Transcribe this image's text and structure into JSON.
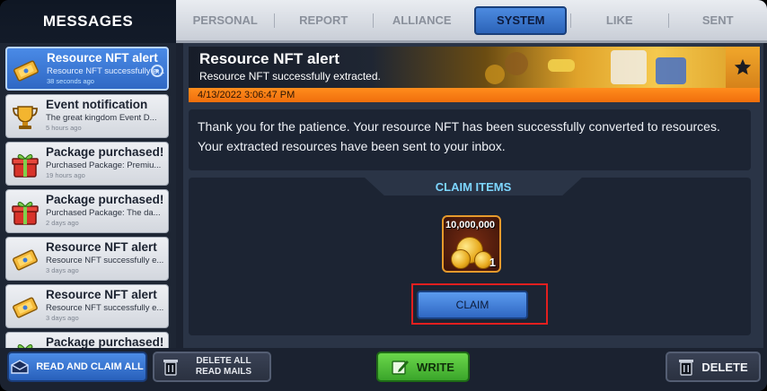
{
  "header": {
    "title": "MESSAGES"
  },
  "tabs": [
    {
      "label": "PERSONAL",
      "active": false
    },
    {
      "label": "REPORT",
      "active": false
    },
    {
      "label": "ALLIANCE",
      "active": false
    },
    {
      "label": "SYSTEM",
      "active": true
    },
    {
      "label": "LIKE",
      "active": false
    },
    {
      "label": "SENT",
      "active": false
    }
  ],
  "mails": [
    {
      "title": "Resource NFT alert",
      "preview": "Resource NFT successfully e...",
      "time": "38 seconds ago",
      "icon": "ticket-icon",
      "selected": true
    },
    {
      "title": "Event notification",
      "preview": "The great kingdom Event D...",
      "time": "5 hours ago",
      "icon": "trophy-icon",
      "selected": false
    },
    {
      "title": "Package purchased!",
      "preview": "Purchased Package: Premiu...",
      "time": "19 hours ago",
      "icon": "gift-icon",
      "selected": false
    },
    {
      "title": "Package purchased!",
      "preview": "Purchased Package: The da...",
      "time": "2 days ago",
      "icon": "gift-icon",
      "selected": false
    },
    {
      "title": "Resource NFT alert",
      "preview": "Resource NFT successfully e...",
      "time": "3 days ago",
      "icon": "ticket-icon",
      "selected": false
    },
    {
      "title": "Resource NFT alert",
      "preview": "Resource NFT successfully e...",
      "time": "3 days ago",
      "icon": "ticket-icon",
      "selected": false
    },
    {
      "title": "Package purchased!",
      "preview": "",
      "time": "",
      "icon": "gift-icon",
      "selected": false
    }
  ],
  "message": {
    "title": "Resource NFT alert",
    "subtitle": "Resource NFT successfully extracted.",
    "date": "4/13/2022 3:06:47 PM",
    "body": "Thank you for the patience. Your resource NFT has been successfully converted to resources. Your extracted resources have been sent to your inbox."
  },
  "claim": {
    "header": "CLAIM ITEMS",
    "item_amount": "10,000,000",
    "item_qty": "1",
    "item_icon": "gold-coins-icon",
    "button": "CLAIM"
  },
  "footer": {
    "read_claim_all": "READ AND CLAIM ALL",
    "delete_all_read": "DELETE ALL READ MAILS",
    "write": "WRITE",
    "delete": "DELETE"
  },
  "colors": {
    "accent_blue": "#2f68c4",
    "banner_orange": "#f06e0c",
    "claim_header": "#7dd6ff",
    "highlight_red": "#e21f1f",
    "write_green": "#3aa52a"
  }
}
